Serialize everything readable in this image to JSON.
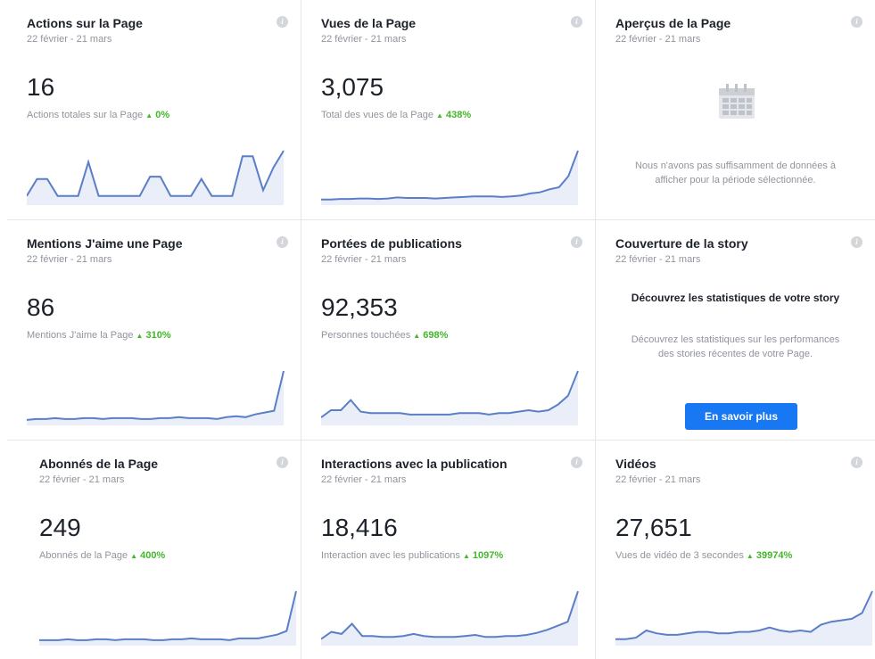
{
  "cards": [
    {
      "title": "Actions sur la Page",
      "date": "22 février - 21 mars",
      "value": "16",
      "sub": "Actions totales sur la Page",
      "delta": "0%",
      "series": [
        5,
        20,
        20,
        5,
        5,
        5,
        35,
        5,
        5,
        5,
        5,
        5,
        22,
        22,
        5,
        5,
        5,
        20,
        5,
        5,
        5,
        40,
        40,
        10,
        30,
        45
      ]
    },
    {
      "title": "Vues de la Page",
      "date": "22 février - 21 mars",
      "value": "3,075",
      "sub": "Total des vues de la Page",
      "delta": "438%",
      "series": [
        2,
        2,
        2.5,
        2.5,
        3,
        3,
        2.5,
        3,
        4,
        3.5,
        3.5,
        3.5,
        3,
        3.5,
        4,
        4.5,
        5,
        5,
        5,
        4.5,
        5,
        6,
        8,
        9,
        12,
        14,
        25,
        50
      ]
    },
    {
      "title": "Aperçus de la Page",
      "date": "22 février - 21 mars",
      "message": "Nous n'avons pas suffisamment de données à afficher pour la période sélectionnée.",
      "icon": "calendar-icon"
    },
    {
      "title": "Mentions J'aime une Page",
      "date": "22 février - 21 mars",
      "value": "86",
      "sub": "Mentions J'aime la Page",
      "delta": "310%",
      "series": [
        2,
        3,
        3,
        4,
        3,
        3,
        4,
        4,
        3,
        4,
        4,
        4,
        3,
        3,
        4,
        4,
        5,
        4,
        4,
        4,
        3,
        5,
        6,
        5,
        8,
        10,
        12,
        55
      ]
    },
    {
      "title": "Portées de publications",
      "date": "22 février - 21 mars",
      "value": "92,353",
      "sub": "Personnes touchées",
      "delta": "698%",
      "series": [
        3,
        8,
        8,
        15,
        7,
        6,
        6,
        6,
        6,
        5,
        5,
        5,
        5,
        5,
        6,
        6,
        6,
        5,
        6,
        6,
        7,
        8,
        7,
        8,
        12,
        18,
        35
      ]
    },
    {
      "title": "Couverture de la story",
      "date": "22 février - 21 mars",
      "story_title": "Découvrez les statistiques de votre story",
      "message": "Découvrez les statistiques sur les performances des stories récentes de votre Page.",
      "button": "En savoir plus"
    },
    {
      "title": "Abonnés de la Page",
      "date": "22 février - 21 mars",
      "value": "249",
      "sub": "Abonnés de la Page",
      "delta": "400%",
      "series": [
        2,
        2,
        2,
        3,
        2,
        2,
        3,
        3,
        2,
        3,
        3,
        3,
        2,
        2,
        3,
        3,
        4,
        3,
        3,
        3,
        2,
        4,
        4,
        4,
        6,
        8,
        12,
        55
      ]
    },
    {
      "title": "Interactions avec la publication",
      "date": "22 février - 21 mars",
      "value": "18,416",
      "sub": "Interaction avec les publications",
      "delta": "1097%",
      "series": [
        3,
        10,
        8,
        18,
        6,
        6,
        5,
        5,
        6,
        8,
        6,
        5,
        5,
        5,
        6,
        7,
        5,
        5,
        6,
        6,
        7,
        9,
        12,
        16,
        20,
        50
      ]
    },
    {
      "title": "Vidéos",
      "date": "22 février - 21 mars",
      "value": "27,651",
      "sub": "Vues de vidéo de 3 secondes",
      "delta": "39974%",
      "series": [
        2,
        2,
        3,
        8,
        6,
        5,
        5,
        6,
        7,
        7,
        6,
        6,
        7,
        7,
        8,
        10,
        8,
        7,
        8,
        7,
        12,
        14,
        15,
        16,
        20,
        35
      ]
    }
  ],
  "colors": {
    "line": "#5b7fc7",
    "fill": "#e9eef8",
    "accent": "#42b72a",
    "button": "#1877f2"
  }
}
